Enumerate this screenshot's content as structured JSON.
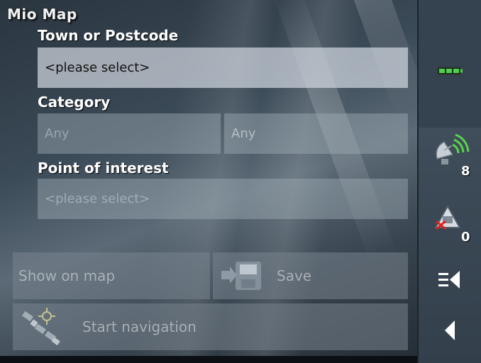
{
  "app": {
    "title": "Mio Map"
  },
  "form": {
    "town_label": "Town or Postcode",
    "town_value": "<please select>",
    "category_label": "Category",
    "category_main_value": "Any",
    "category_sub_value": "Any",
    "poi_label": "Point of interest",
    "poi_value": "<please select>"
  },
  "actions": {
    "show_on_map_label": "Show on map",
    "save_label": "Save",
    "start_navigation_label": "Start navigation"
  },
  "sidebar": {
    "satellite_count": "8",
    "warning_count": "0",
    "battery_icon": "battery-icon",
    "satellite_icon": "satellite-signal-icon",
    "warning_icon": "safety-camera-off-icon",
    "menu_icon": "menu-collapse-icon",
    "back_icon": "back-arrow-icon"
  },
  "colors": {
    "battery": "#4fd14f",
    "satellite": "#5ad24a",
    "warning_x": "#e02020"
  }
}
